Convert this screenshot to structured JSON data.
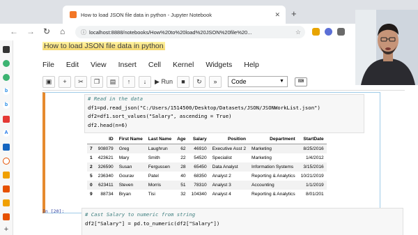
{
  "browser": {
    "tab_title": "How to load JSON file data in python - Jupyter Notebook",
    "tab_close": "✕",
    "new_tab": "+",
    "url": "localhost:8888/notebooks/How%20to%20load%20JSON%20file%20..."
  },
  "notebook": {
    "title": "How to load JSON file data in python",
    "menu": [
      "File",
      "Edit",
      "View",
      "Insert",
      "Cell",
      "Kernel",
      "Widgets",
      "Help"
    ],
    "toolbar": {
      "run_label": "Run",
      "cell_type": "Code"
    }
  },
  "cell1": {
    "lines": [
      "# Read in the data",
      "df1=pd.read_json(\"C:/Users/1514500/Desktop/Datasets/JSON/JSONWorkList.json\")",
      "df2=df1.sort_values(\"Salary\", ascending = True)",
      "df2.head(n=6)"
    ]
  },
  "table": {
    "columns": [
      "",
      "ID",
      "First Name",
      "Last Name",
      "Age",
      "Salary",
      "Position",
      "Department",
      "StartDate"
    ],
    "rows": [
      [
        "7",
        "908079",
        "Greg",
        "Laughrun",
        "62",
        "46910",
        "Executive Asst 2",
        "Marketing",
        "8/25/2016"
      ],
      [
        "1",
        "423621",
        "Mary",
        "Smith",
        "22",
        "54520",
        "Specialist",
        "Marketing",
        "1/4/2012"
      ],
      [
        "2",
        "326590",
        "Susan",
        "Fergussen",
        "28",
        "65450",
        "Data Analyst",
        "Information Systems",
        "3/15/2016"
      ],
      [
        "5",
        "236340",
        "Gourav",
        "Patel",
        "40",
        "68350",
        "Analyst 2",
        "Reporting & Analytics",
        "10/21/2019"
      ],
      [
        "0",
        "623411",
        "Steven",
        "Morris",
        "51",
        "78310",
        "Analyst 3",
        "Accounting",
        "1/1/2019"
      ],
      [
        "9",
        "88734",
        "Bryan",
        "Tisi",
        "32",
        "104340",
        "Analyst 4",
        "Reporting & Analytics",
        "8/01/201"
      ]
    ]
  },
  "cell2": {
    "prompt": "In [20]:",
    "lines": [
      "# Cast Salary to numeric from string",
      "df2[\"Salary\"] = pd.to_numeric(df2[\"Salary\"])"
    ]
  }
}
